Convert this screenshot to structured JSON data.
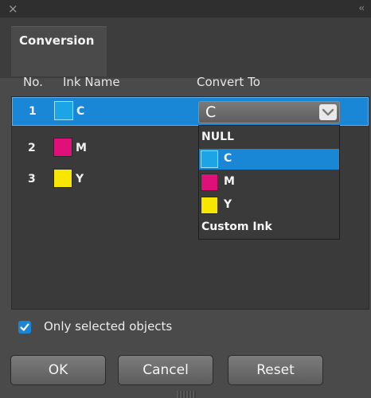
{
  "window": {
    "close_glyph": "×",
    "collapse_glyph": "‹‹"
  },
  "tabs": [
    {
      "label": "Conversion"
    }
  ],
  "columns": {
    "no": "No.",
    "ink_name": "Ink Name",
    "convert_to": "Convert To"
  },
  "rows": [
    {
      "no": "1",
      "ink": "C",
      "color": "#1ca5e6",
      "selected": true
    },
    {
      "no": "2",
      "ink": "M",
      "color": "#e0107a",
      "selected": false
    },
    {
      "no": "3",
      "ink": "Y",
      "color": "#f7e600",
      "selected": false
    }
  ],
  "convert_select": {
    "value": "C",
    "options": [
      {
        "label": "NULL",
        "color": null
      },
      {
        "label": "C",
        "color": "#1ca5e6",
        "selected": true
      },
      {
        "label": "M",
        "color": "#e0107a"
      },
      {
        "label": "Y",
        "color": "#f7e600"
      },
      {
        "label": "Custom Ink",
        "color": null
      }
    ]
  },
  "only_selected": {
    "label": "Only selected objects",
    "checked": true
  },
  "buttons": {
    "ok": "OK",
    "cancel": "Cancel",
    "reset": "Reset"
  },
  "colors": {
    "accent": "#1a86d6",
    "panel": "#4a4a4a",
    "cyan": "#1ca5e6",
    "magenta": "#e0107a",
    "yellow": "#f7e600"
  },
  "icons": {
    "close": "close-icon",
    "collapse": "double-chevron-left-icon",
    "dropdown": "chevron-down-icon",
    "check": "checkmark-icon"
  }
}
